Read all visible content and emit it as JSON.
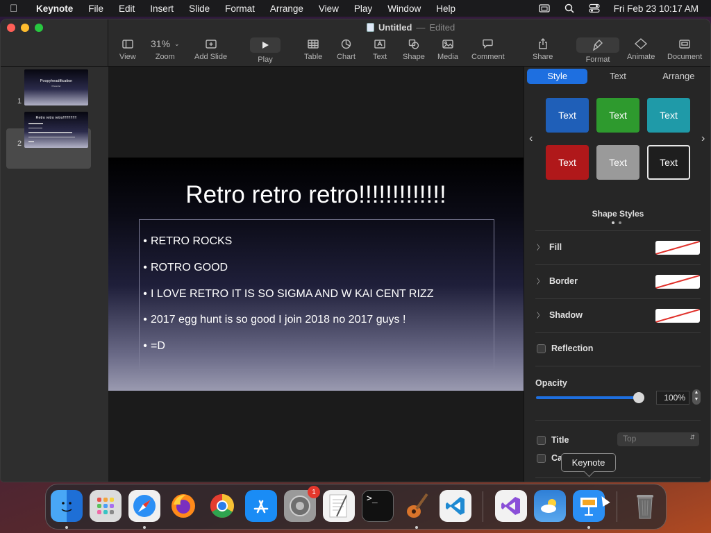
{
  "menubar": {
    "app_name": "Keynote",
    "items": [
      "File",
      "Edit",
      "Insert",
      "Slide",
      "Format",
      "Arrange",
      "View",
      "Play",
      "Window",
      "Help"
    ],
    "datetime": "Fri Feb 23  10:17 AM"
  },
  "window": {
    "doc_name": "Untitled",
    "doc_separator": "—",
    "doc_status": "Edited"
  },
  "toolbar": {
    "view": "View",
    "zoom_value": "31%",
    "zoom": "Zoom",
    "add_slide": "Add Slide",
    "play": "Play",
    "table": "Table",
    "chart": "Chart",
    "text": "Text",
    "shape": "Shape",
    "media": "Media",
    "comment": "Comment",
    "share": "Share",
    "format": "Format",
    "animate": "Animate",
    "document": "Document"
  },
  "navigator": {
    "slides": [
      {
        "number": "1",
        "title": "Poopyheadification",
        "subtitle": "Presenter"
      },
      {
        "number": "2",
        "title": "Retro retro retro!!!!!!!!!!!!!"
      }
    ],
    "selected_index": 1
  },
  "slide": {
    "title": "Retro retro retro!!!!!!!!!!!!!",
    "bullets": [
      "RETRO ROCKS",
      "ROTRO GOOD",
      "I LOVE RETRO IT IS SO SIGMA AND W KAI CENT RIZZ",
      "2017 egg hunt is so good I join 2018 no 2017 guys !",
      "=D"
    ]
  },
  "inspector": {
    "tabs": [
      "Style",
      "Text",
      "Arrange"
    ],
    "active_tab": "Style",
    "style_buttons": [
      {
        "label": "Text",
        "color": "#1f5fb8"
      },
      {
        "label": "Text",
        "color": "#2e9a2e"
      },
      {
        "label": "Text",
        "color": "#1f9aa8"
      },
      {
        "label": "Text",
        "color": "#b0181a"
      },
      {
        "label": "Text",
        "color": "#9a9a9a"
      },
      {
        "label": "Text",
        "color": "#1e1e1e"
      }
    ],
    "shape_styles_label": "Shape Styles",
    "fill": "Fill",
    "border": "Border",
    "shadow": "Shadow",
    "reflection": "Reflection",
    "opacity_label": "Opacity",
    "opacity_value": "100%",
    "opacity_fraction": 1.0,
    "title_label": "Title",
    "title_position": "Top",
    "caption_label": "Caption"
  },
  "dock": {
    "tooltip": "Keynote",
    "apps": [
      {
        "name": "Finder",
        "icon": "finder-icon",
        "color": "#2b8bf2",
        "running": true
      },
      {
        "name": "Launchpad",
        "icon": "launchpad-icon",
        "color": "#8a8a9a",
        "running": false
      },
      {
        "name": "Safari",
        "icon": "safari-icon",
        "color": "#2a8ff5",
        "running": true
      },
      {
        "name": "Firefox",
        "icon": "firefox-icon",
        "color": "#ff7a1a",
        "running": false
      },
      {
        "name": "Chrome",
        "icon": "chrome-icon",
        "color": "#f2f2f2",
        "running": false
      },
      {
        "name": "App Store",
        "icon": "app-store-icon",
        "color": "#1a8cf5",
        "running": false
      },
      {
        "name": "System Settings",
        "icon": "settings-icon",
        "color": "#8a8a8a",
        "running": false,
        "badge": "1"
      },
      {
        "name": "TextEdit",
        "icon": "textedit-icon",
        "color": "#f0f0f0",
        "running": false
      },
      {
        "name": "Terminal",
        "icon": "terminal-icon",
        "color": "#111111",
        "running": false
      },
      {
        "name": "GarageBand",
        "icon": "garageband-icon",
        "color": "#5a3a2a",
        "running": true
      },
      {
        "name": "VS Code",
        "icon": "vscode-icon",
        "color": "#1f8ad2",
        "running": false
      },
      {
        "name": "Visual Studio",
        "icon": "visual-studio-icon",
        "color": "#f2f2f2",
        "running": false
      },
      {
        "name": "Weather",
        "icon": "weather-icon",
        "color": "#3a8ad8",
        "running": false
      },
      {
        "name": "Keynote",
        "icon": "keynote-icon",
        "color": "#2a8ff5",
        "running": true
      },
      {
        "name": "Trash",
        "icon": "trash-icon",
        "color": "#555555",
        "running": false
      }
    ]
  }
}
